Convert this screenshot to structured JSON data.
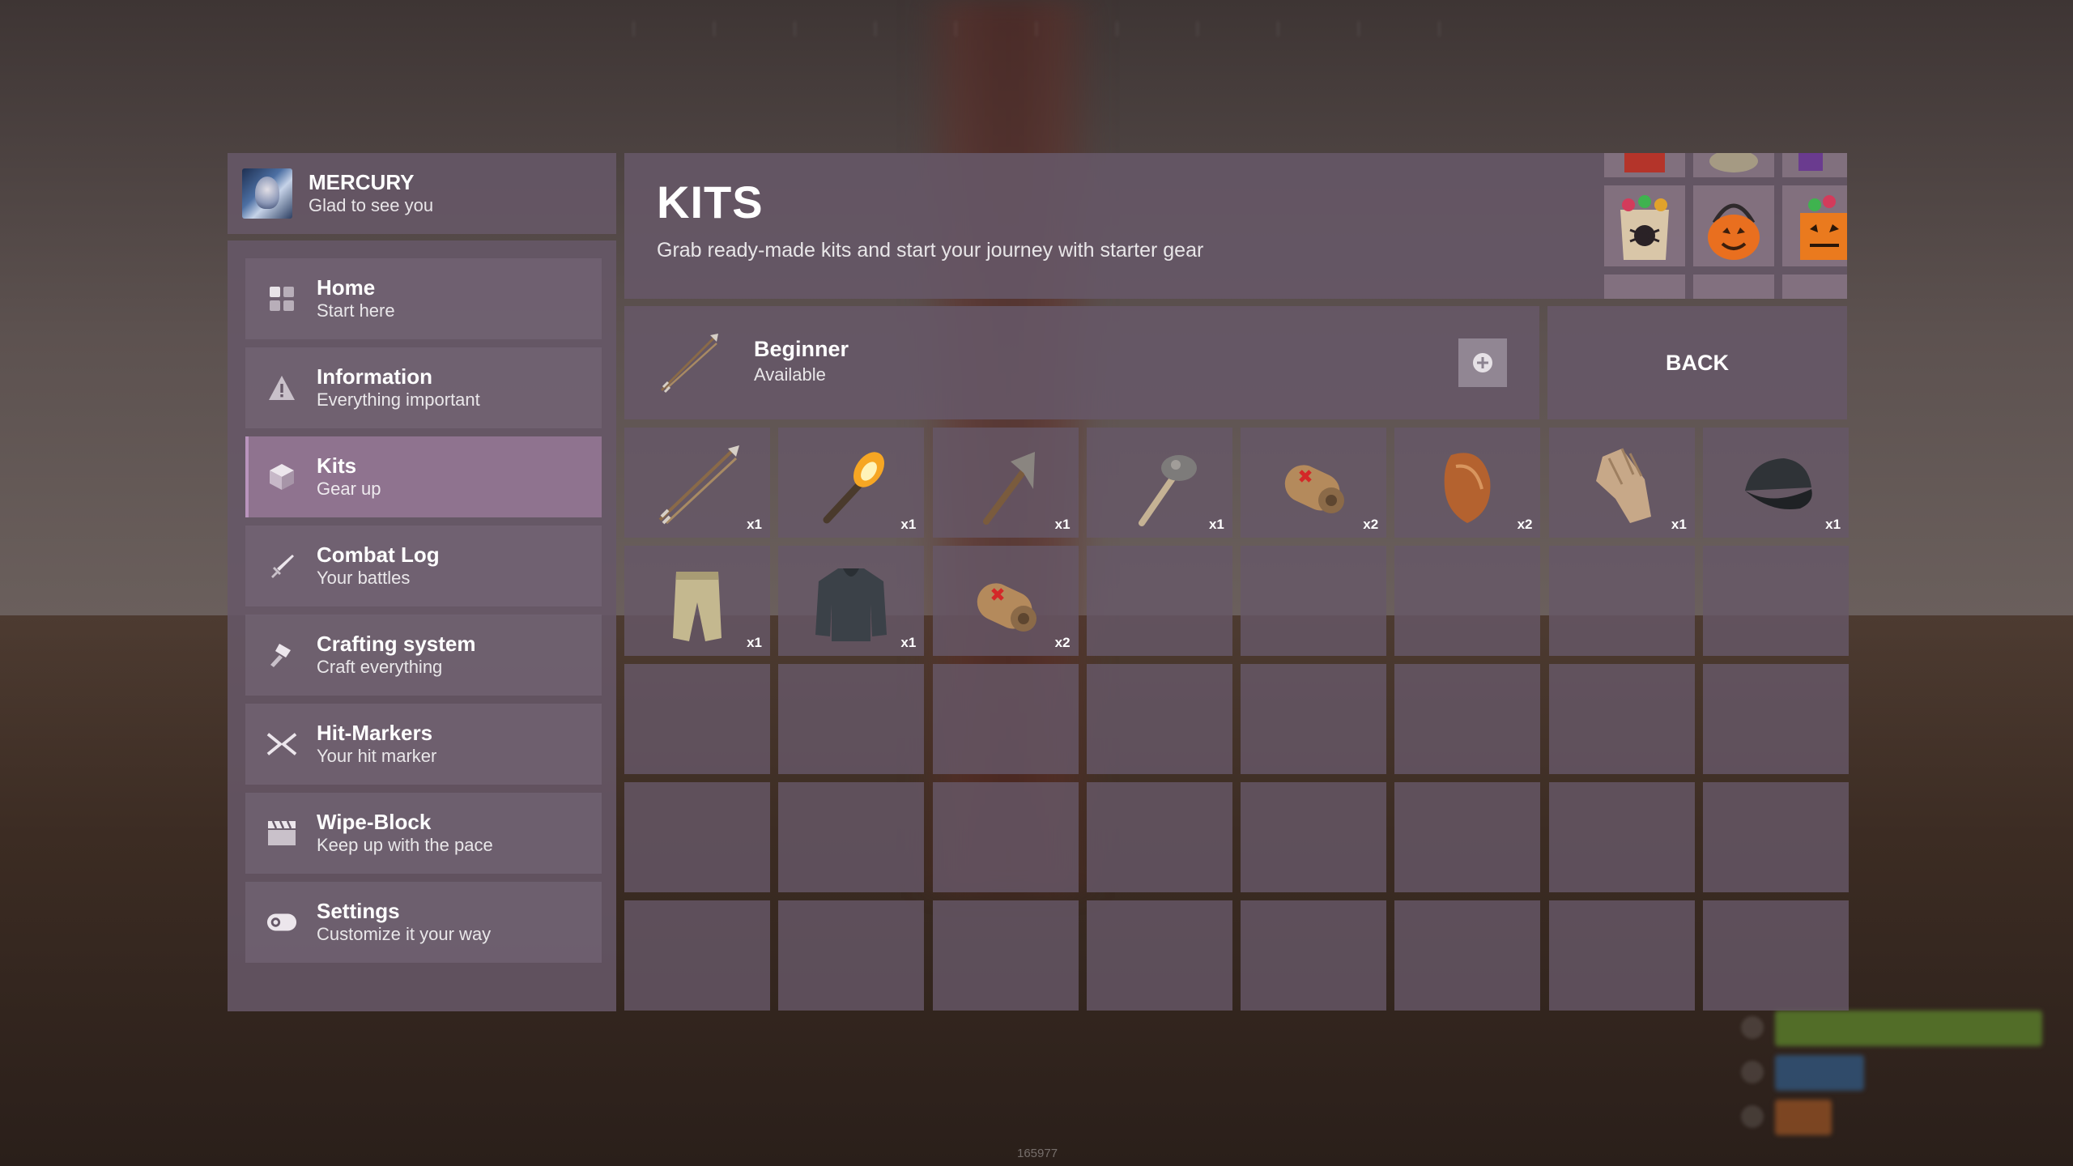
{
  "hud": {
    "build_id": "165977"
  },
  "profile": {
    "name": "MERCURY",
    "greeting": "Glad to see you"
  },
  "nav": [
    {
      "title": "Home",
      "subtitle": "Start here",
      "icon": "grid-icon",
      "active": false
    },
    {
      "title": "Information",
      "subtitle": "Everything important",
      "icon": "warning-icon",
      "active": false
    },
    {
      "title": "Kits",
      "subtitle": "Gear up",
      "icon": "cube-icon",
      "active": true
    },
    {
      "title": "Combat Log",
      "subtitle": "Your battles",
      "icon": "sword-icon",
      "active": false
    },
    {
      "title": "Crafting system",
      "subtitle": "Craft everything",
      "icon": "hammer-icon",
      "active": false
    },
    {
      "title": "Hit-Markers",
      "subtitle": "Your hit marker",
      "icon": "crossed-swords-icon",
      "active": false
    },
    {
      "title": "Wipe-Block",
      "subtitle": "Keep up with the pace",
      "icon": "clapperboard-icon",
      "active": false
    },
    {
      "title": "Settings",
      "subtitle": "Customize it your way",
      "icon": "toggle-icon",
      "active": false
    }
  ],
  "header": {
    "title": "KITS",
    "subtitle": "Grab ready-made kits and start your journey with starter gear"
  },
  "kit": {
    "name": "Beginner",
    "status": "Available",
    "icon": "bow-arrow-icon"
  },
  "back_label": "BACK",
  "items": [
    {
      "icon": "arrow-icon",
      "count": "x1"
    },
    {
      "icon": "torch-icon",
      "count": "x1"
    },
    {
      "icon": "stone-pickaxe-icon",
      "count": "x1"
    },
    {
      "icon": "stone-hatchet-icon",
      "count": "x1"
    },
    {
      "icon": "bandage-roll-icon",
      "count": "x2"
    },
    {
      "icon": "cooked-meat-icon",
      "count": "x2"
    },
    {
      "icon": "leather-gloves-icon",
      "count": "x1"
    },
    {
      "icon": "baseball-cap-icon",
      "count": "x1"
    },
    {
      "icon": "pants-icon",
      "count": "x1"
    },
    {
      "icon": "hoodie-icon",
      "count": "x1"
    },
    {
      "icon": "bandage-roll-icon",
      "count": "x2"
    }
  ],
  "grid": {
    "columns": 8,
    "rows": 5
  },
  "colors": {
    "panel": "#665868",
    "active": "#967896",
    "accent": "#b994bd"
  }
}
